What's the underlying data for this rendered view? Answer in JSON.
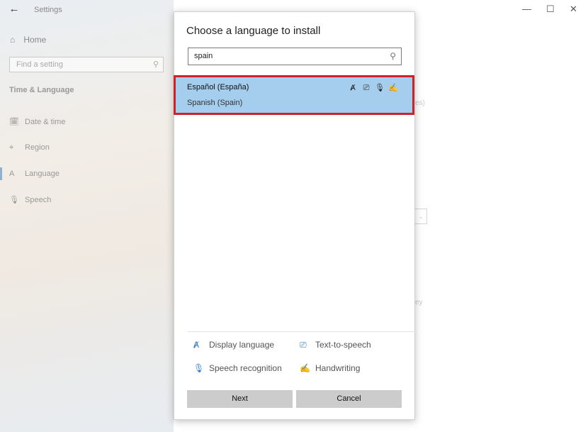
{
  "settings": {
    "title": "Settings",
    "back_icon": "←",
    "home_label": "Home",
    "find_placeholder": "Find a setting",
    "section_title": "Time & Language",
    "nav": [
      {
        "label": "Date & time",
        "icon": "🗓"
      },
      {
        "label": "Region",
        "icon": "⌖"
      },
      {
        "label": "Language",
        "icon": "A"
      },
      {
        "label": "Speech",
        "icon": "🎙"
      }
    ],
    "window_controls": {
      "minimize": "—",
      "maximize": "☐",
      "close": "✕"
    },
    "bg_fragments": {
      "a": "es)",
      "b": "ey"
    }
  },
  "dialog": {
    "title": "Choose a language to install",
    "search_value": "spain",
    "results": [
      {
        "native": "Español (España)",
        "english": "Spanish (Spain)"
      }
    ],
    "legend": {
      "display_language": "Display language",
      "text_to_speech": "Text-to-speech",
      "speech_recognition": "Speech recognition",
      "handwriting": "Handwriting"
    },
    "buttons": {
      "next": "Next",
      "cancel": "Cancel"
    }
  },
  "colors": {
    "selection": "#a5cdee",
    "highlight_border": "#d0202a",
    "accent_icon": "#2e79c2",
    "button": "#cccccc"
  }
}
